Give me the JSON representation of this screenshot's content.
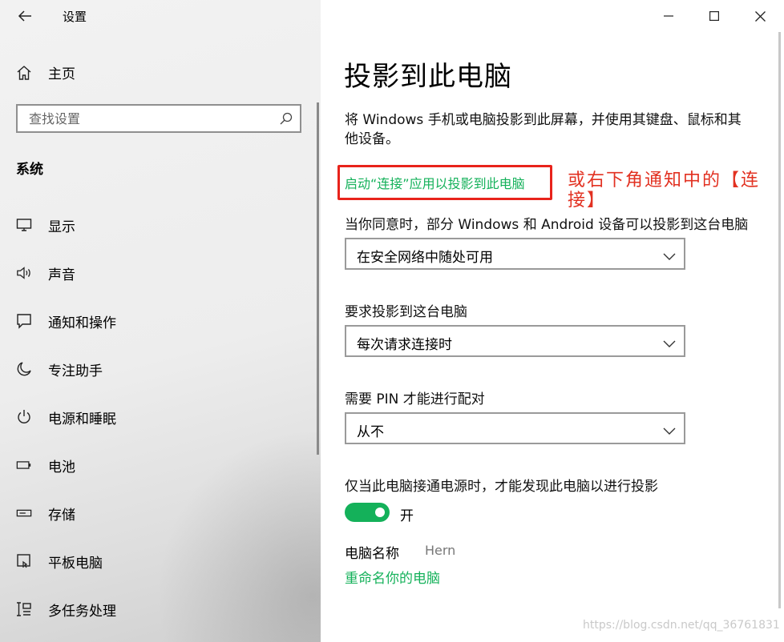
{
  "app": {
    "title": "设置"
  },
  "sidebar": {
    "home_label": "主页",
    "search_placeholder": "查找设置",
    "section_title": "系统",
    "items": [
      {
        "label": "显示",
        "icon": "monitor-icon"
      },
      {
        "label": "声音",
        "icon": "speaker-icon"
      },
      {
        "label": "通知和操作",
        "icon": "notification-icon"
      },
      {
        "label": "专注助手",
        "icon": "moon-icon"
      },
      {
        "label": "电源和睡眠",
        "icon": "power-icon"
      },
      {
        "label": "电池",
        "icon": "battery-icon"
      },
      {
        "label": "存储",
        "icon": "storage-icon"
      },
      {
        "label": "平板电脑",
        "icon": "tablet-icon"
      },
      {
        "label": "多任务处理",
        "icon": "multitask-icon"
      }
    ]
  },
  "main": {
    "title": "投影到此电脑",
    "description": "将 Windows 手机或电脑投影到此屏幕，并使用其键盘、鼠标和其他设备。",
    "launch_link": "启动“连接”应用以投影到此电脑",
    "annotation": "或右下角通知中的【连接】",
    "setting1": {
      "label": "当你同意时，部分 Windows 和 Android 设备可以投影到这台电脑",
      "value": "在安全网络中随处可用"
    },
    "setting2": {
      "label": "要求投影到这台电脑",
      "value": "每次请求连接时"
    },
    "setting3": {
      "label": "需要 PIN 才能进行配对",
      "value": "从不"
    },
    "power_setting": {
      "label": "仅当此电脑接通电源时，才能发现此电脑以进行投影",
      "state": "开",
      "on": true
    },
    "pc_name": {
      "label": "电脑名称",
      "value": "Hern"
    },
    "rename_link": "重命名你的电脑"
  },
  "watermark": "https://blog.csdn.net/qq_36761831",
  "colors": {
    "accent": "#14b15a",
    "annotation": "#e23121",
    "box": "#e8231b"
  }
}
